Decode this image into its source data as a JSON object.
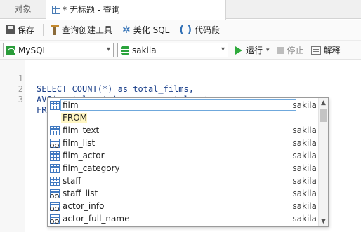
{
  "tabs": {
    "objects": "对象",
    "query": "* 无标题 - 查询"
  },
  "toolbar": {
    "save": "保存",
    "query_builder": "查询创建工具",
    "beautify": "美化 SQL",
    "snippet": "代码段"
  },
  "connection_bar": {
    "connection": "MySQL",
    "database": "sakila",
    "run": "运行",
    "stop": "停止",
    "explain": "解释"
  },
  "editor": {
    "lines": [
      {
        "num": "1",
        "text": "SELECT COUNT(*) as total_films,"
      },
      {
        "num": "2",
        "text": "AVG(rental_rate) as avg_rental_rate,"
      },
      {
        "num": "3",
        "text": "FROM f"
      }
    ]
  },
  "autocomplete": {
    "items": [
      {
        "name": "film",
        "schema": "sakila",
        "icon": "table-icon",
        "selected": true
      },
      {
        "name": "FROM",
        "schema": "",
        "icon": "keyword",
        "selected": false
      },
      {
        "name": "film_text",
        "schema": "sakila",
        "icon": "table-icon",
        "selected": false
      },
      {
        "name": "film_list",
        "schema": "sakila",
        "icon": "view-icon",
        "selected": false
      },
      {
        "name": "film_actor",
        "schema": "sakila",
        "icon": "table-icon",
        "selected": false
      },
      {
        "name": "film_category",
        "schema": "sakila",
        "icon": "table-icon",
        "selected": false
      },
      {
        "name": "staff",
        "schema": "sakila",
        "icon": "table-icon",
        "selected": false
      },
      {
        "name": "staff_list",
        "schema": "sakila",
        "icon": "view-icon",
        "selected": false
      },
      {
        "name": "actor_info",
        "schema": "sakila",
        "icon": "view-icon",
        "selected": false
      },
      {
        "name": "actor_full_name",
        "schema": "sakila",
        "icon": "view-icon",
        "selected": false
      }
    ]
  },
  "colors": {
    "accent": "#3f78c0",
    "run_green": "#2faa3c",
    "mysql_green": "#2a9d3a"
  }
}
